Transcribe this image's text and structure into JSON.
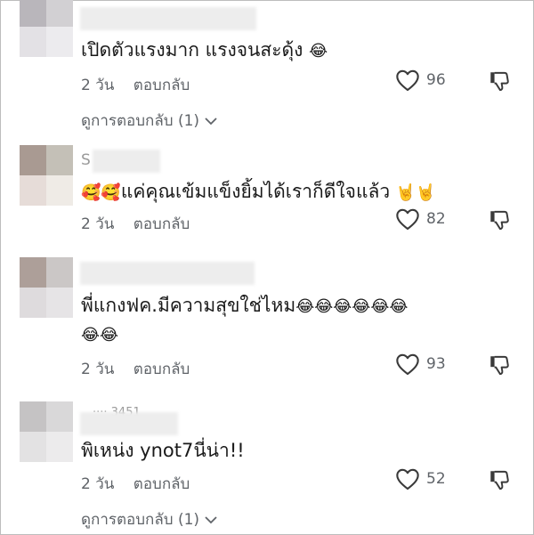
{
  "comments": [
    {
      "name_fragment": "",
      "text": "เปิดตัวแรงมาก แรงจนสะดุ้ง",
      "text_emoji": "😂",
      "text_line2": "",
      "time": "2 วัน",
      "reply_label": "ตอบกลับ",
      "likes": "96",
      "view_replies": "ดูการตอบกลับ (1)"
    },
    {
      "name_fragment": "S",
      "text_emoji_pre": "🥰🥰",
      "text": "แค่คุณเข้มแข็งยิ้มได้เราก็ดีใจแล้ว",
      "text_emoji": "🤘🤘",
      "text_line2": "",
      "time": "2 วัน",
      "reply_label": "ตอบกลับ",
      "likes": "82",
      "view_replies": ""
    },
    {
      "name_fragment": "",
      "text": "พี่แกงฟค.มีความสุขใช่ไหม",
      "text_emoji": "😂😂😂😂😂😂",
      "text_line2": "😂😂",
      "time": "2 วัน",
      "reply_label": "ตอบกลับ",
      "likes": "93",
      "view_replies": ""
    },
    {
      "name_fragment": "···· 3451",
      "text": "พิเหน่ง ynot7นี่น่า!!",
      "text_emoji": "",
      "text_line2": "",
      "time": "2 วัน",
      "reply_label": "ตอบกลับ",
      "likes": "52",
      "view_replies": "ดูการตอบกลับ (1)"
    }
  ],
  "icons": {
    "like": "heart-outline-icon",
    "dislike": "thumbs-down-icon",
    "expand": "chevron-down-icon"
  },
  "colors": {
    "text": "#1a1a1a",
    "meta": "#5f6368",
    "icon": "#3a3a3a"
  }
}
